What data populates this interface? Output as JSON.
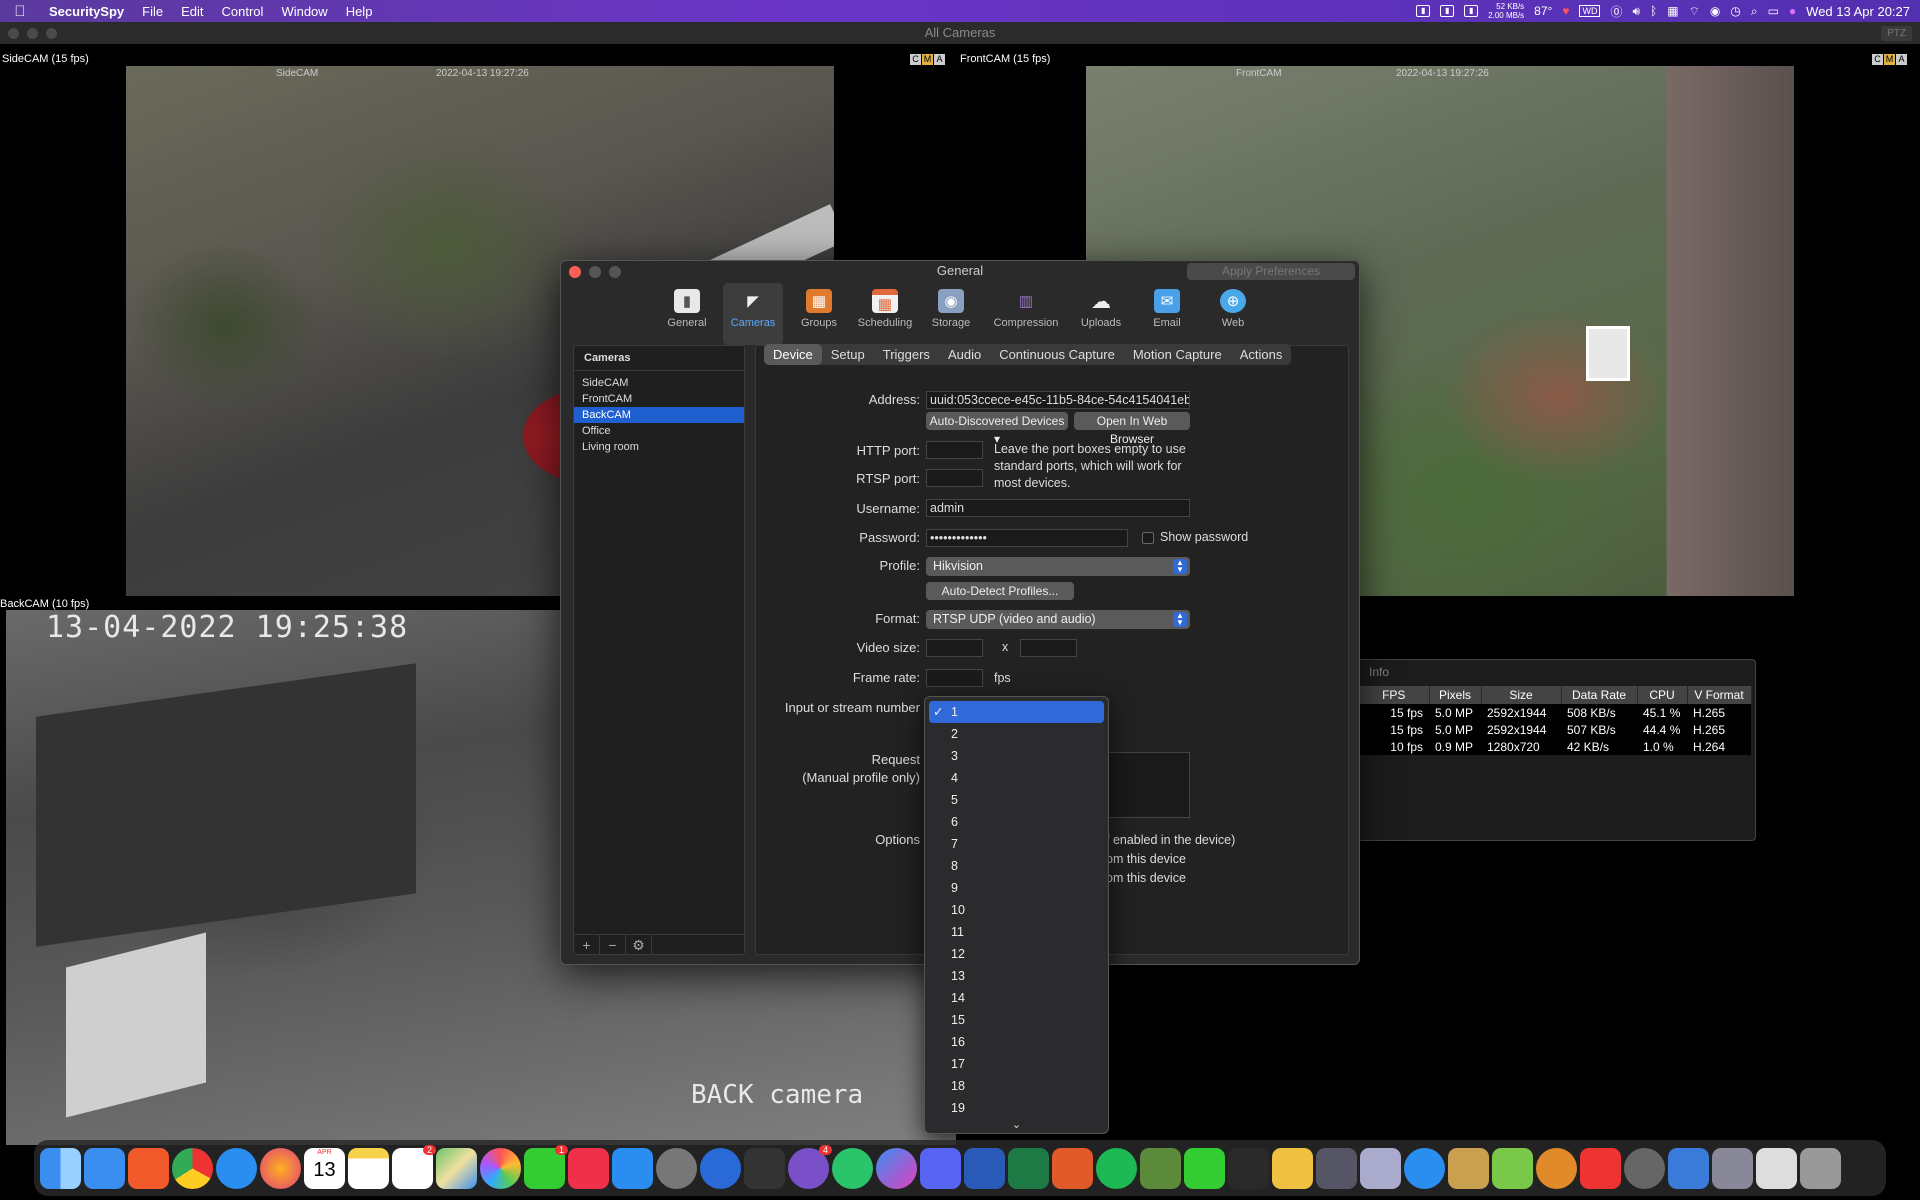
{
  "menubar": {
    "app_name": "SecuritySpy",
    "menus": [
      "File",
      "Edit",
      "Control",
      "Window",
      "Help"
    ],
    "net_up": "52 KB/s",
    "net_down": "2.00 MB/s",
    "temp": "87°",
    "date_time": "Wed 13 Apr  20:27"
  },
  "main_window": {
    "title": "All Cameras",
    "ptz_label": "PTZ"
  },
  "cameras_view": {
    "side": {
      "label": "SideCAM (15 fps)",
      "name": "SideCAM",
      "timestamp": "2022-04-13 19:27:26"
    },
    "front": {
      "label": "FrontCAM (15 fps)",
      "name": "FrontCAM",
      "timestamp": "2022-04-13 19:27:26"
    },
    "back": {
      "label": "BackCAM (10 fps)",
      "overlay_time": "13-04-2022 19:25:38",
      "overlay_name": "BACK camera"
    },
    "cma": [
      "C",
      "M",
      "A"
    ]
  },
  "prefs": {
    "title": "General",
    "apply_button": "Apply Preferences",
    "toolbar": [
      {
        "label": "General",
        "icon": "general-icon",
        "color": "#bbbbbb"
      },
      {
        "label": "Cameras",
        "icon": "cameras-icon",
        "color": "#dddddd"
      },
      {
        "label": "Groups",
        "icon": "groups-icon",
        "color": "#e07a2c"
      },
      {
        "label": "Scheduling",
        "icon": "calendar-icon",
        "color": "#e06a3c"
      },
      {
        "label": "Storage",
        "icon": "storage-icon",
        "color": "#8aa0c0"
      },
      {
        "label": "Compression",
        "icon": "compression-icon",
        "color": "#9a7ac8"
      },
      {
        "label": "Uploads",
        "icon": "cloud-upload-icon",
        "color": "#dddddd"
      },
      {
        "label": "Email",
        "icon": "email-icon",
        "color": "#4aa0e8"
      },
      {
        "label": "Web",
        "icon": "globe-icon",
        "color": "#49a9e8"
      }
    ],
    "camera_list_header": "Cameras",
    "camera_list": [
      "SideCAM",
      "FrontCAM",
      "BackCAM",
      "Office",
      "Living room"
    ],
    "selected_camera": "BackCAM",
    "tabs": [
      "Device",
      "Setup",
      "Triggers",
      "Audio",
      "Continuous Capture",
      "Motion Capture",
      "Actions"
    ],
    "selected_tab": "Device",
    "device": {
      "address_label": "Address:",
      "address_value": "uuid:053ccece-e45c-11b5-84ce-54c4154041eb",
      "auto_discovered_button": "Auto-Discovered Devices ▾",
      "open_web_button": "Open In Web Browser",
      "http_port_label": "HTTP port:",
      "rtsp_port_label": "RTSP port:",
      "port_note": "Leave the port boxes empty to use standard ports, which will work for most devices.",
      "username_label": "Username:",
      "username_value": "admin",
      "password_label": "Password:",
      "password_value": "•••••••••••••",
      "show_password_label": "Show password",
      "profile_label": "Profile:",
      "profile_value": "Hikvision",
      "auto_detect_button": "Auto-Detect Profiles...",
      "format_label": "Format:",
      "format_value": "RTSP UDP (video and audio)",
      "video_size_label": "Video size:",
      "video_size_x": "x",
      "frame_rate_label": "Frame rate:",
      "fps_unit": "fps",
      "input_label": "Input or stream number",
      "request_label": "Request",
      "manual_profile_label": "(Manual profile only)",
      "options_label": "Options",
      "options_line1": "f enabled in the device)",
      "options_line2": "om this device",
      "options_line3": "om this device"
    },
    "stream_dropdown": {
      "selected": "1",
      "options": [
        "1",
        "2",
        "3",
        "4",
        "5",
        "6",
        "7",
        "8",
        "9",
        "10",
        "11",
        "12",
        "13",
        "14",
        "15",
        "16",
        "17",
        "18",
        "19"
      ]
    }
  },
  "info_panel": {
    "title": "Info",
    "columns": [
      "FPS",
      "Pixels",
      "Size",
      "Data Rate",
      "CPU",
      "V Format"
    ],
    "rows": [
      [
        "15 fps",
        "5.0 MP",
        "2592x1944",
        "508 KB/s",
        "45.1 %",
        "H.265"
      ],
      [
        "15 fps",
        "5.0 MP",
        "2592x1944",
        "507 KB/s",
        "44.4 %",
        "H.265"
      ],
      [
        "10 fps",
        "0.9 MP",
        "1280x720",
        "42 KB/s",
        "1.0 %",
        "H.264"
      ]
    ]
  },
  "dock": {
    "calendar_month": "APR",
    "calendar_day": "13",
    "badges": {
      "reminders": "2",
      "facetime": "1",
      "viber": "4"
    },
    "apps": [
      "finder",
      "mail",
      "brave",
      "chrome",
      "safari",
      "firefox",
      "calendar",
      "notes",
      "reminders",
      "maps",
      "photos",
      "facetime",
      "music",
      "app-store",
      "system-preferences",
      "1password",
      "sourcetree",
      "viber",
      "whatsapp",
      "messenger",
      "discord",
      "word",
      "excel",
      "transmit",
      "spotify",
      "frogger",
      "messages",
      "clipboard",
      "securityspy",
      "monitor",
      "network",
      "quicktime",
      "preview",
      "cube",
      "reeder",
      "youtube",
      "disk",
      "migration",
      "utility",
      "file",
      "trash"
    ]
  }
}
